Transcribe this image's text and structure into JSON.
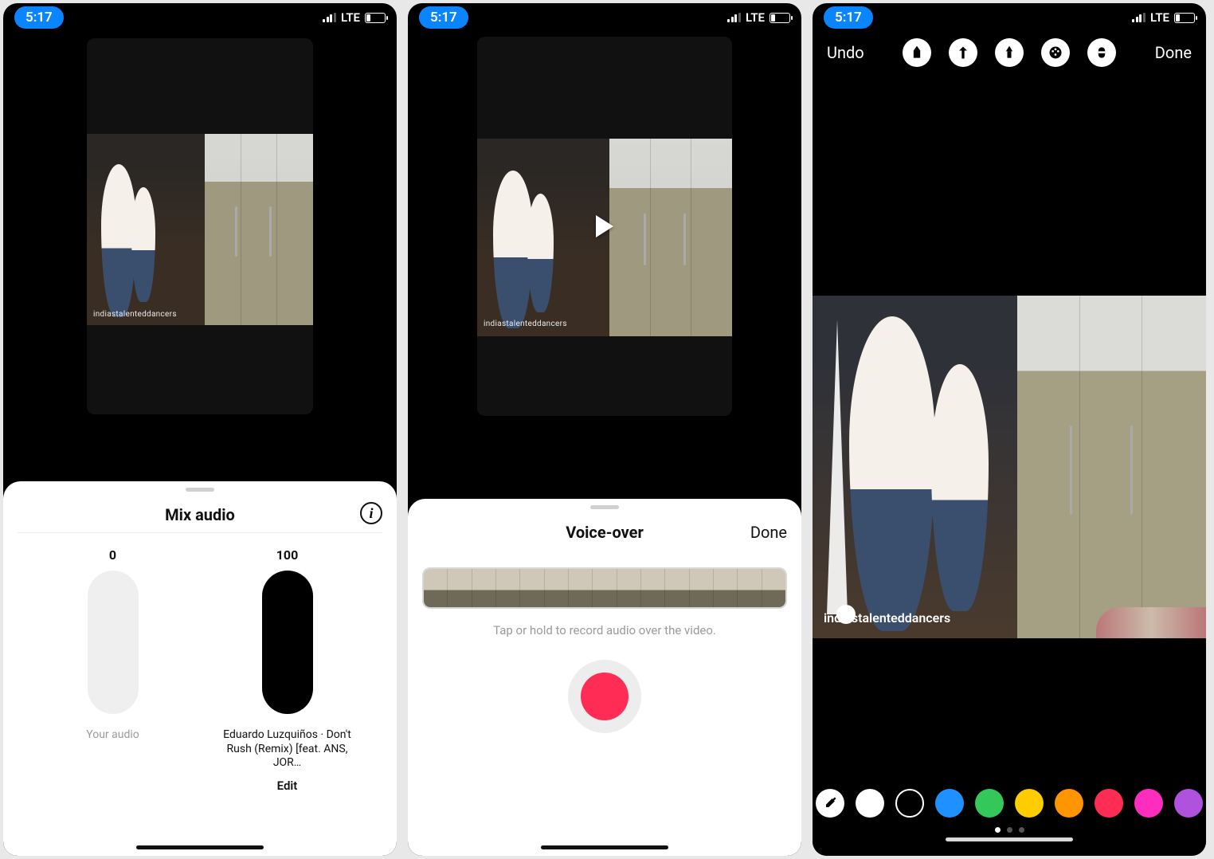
{
  "status": {
    "time": "5:17",
    "network": "LTE"
  },
  "watermark": "indiastalenteddancers",
  "mix": {
    "title": "Mix audio",
    "left_value": "0",
    "right_value": "100",
    "left_label": "Your audio",
    "song": "Eduardo Luzquiños · Don't Rush (Remix) [feat. ANS, JOR…",
    "edit": "Edit"
  },
  "voiceover": {
    "title": "Voice-over",
    "done": "Done",
    "hint": "Tap or hold to record audio over the video."
  },
  "draw": {
    "undo": "Undo",
    "done": "Done",
    "colors": [
      "#ffffff",
      "#000000",
      "#1e90ff",
      "#34c759",
      "#ffcc00",
      "#ff9500",
      "#ff2d55",
      "#ff2dbe",
      "#af52de"
    ]
  }
}
